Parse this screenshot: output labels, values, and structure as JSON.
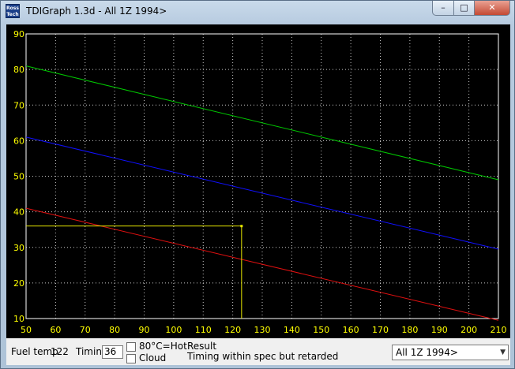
{
  "window": {
    "title": "TDIGraph 1.3d - All 1Z 1994>",
    "icon_text": "Ross Tech",
    "controls": {
      "minimize": "–",
      "maximize": "□",
      "close": "✕"
    }
  },
  "chart_data": {
    "type": "line",
    "xlim": [
      50,
      210
    ],
    "ylim": [
      10,
      90
    ],
    "xticks": [
      50,
      60,
      70,
      80,
      90,
      100,
      110,
      120,
      130,
      140,
      150,
      160,
      170,
      180,
      190,
      200,
      210
    ],
    "yticks": [
      10,
      20,
      30,
      40,
      50,
      60,
      70,
      80,
      90
    ],
    "grid": true,
    "series": [
      {
        "color": "#00c800",
        "x": [
          50,
          210
        ],
        "y": [
          81,
          49
        ]
      },
      {
        "color": "#1010ff",
        "x": [
          50,
          210
        ],
        "y": [
          61,
          29.5
        ]
      },
      {
        "color": "#e01010",
        "x": [
          50,
          210
        ],
        "y": [
          41,
          9.5
        ]
      }
    ],
    "marker": {
      "color": "#e8e800",
      "x": 123,
      "y": 36
    }
  },
  "controls": {
    "fuel_temp_label": "Fuel temp",
    "fuel_temp_value": "122",
    "timing_label": "Timing",
    "timing_value": "36",
    "hot_label": "80°C=Hot",
    "cloud_label": "Cloud",
    "result_label": "Result",
    "result_text": "Timing within spec but retarded",
    "engine_select": "All 1Z 1994>"
  },
  "colors": {
    "plot_background": "#000000",
    "grid": "#c8c8c8",
    "tick_text": "#ffff00"
  }
}
